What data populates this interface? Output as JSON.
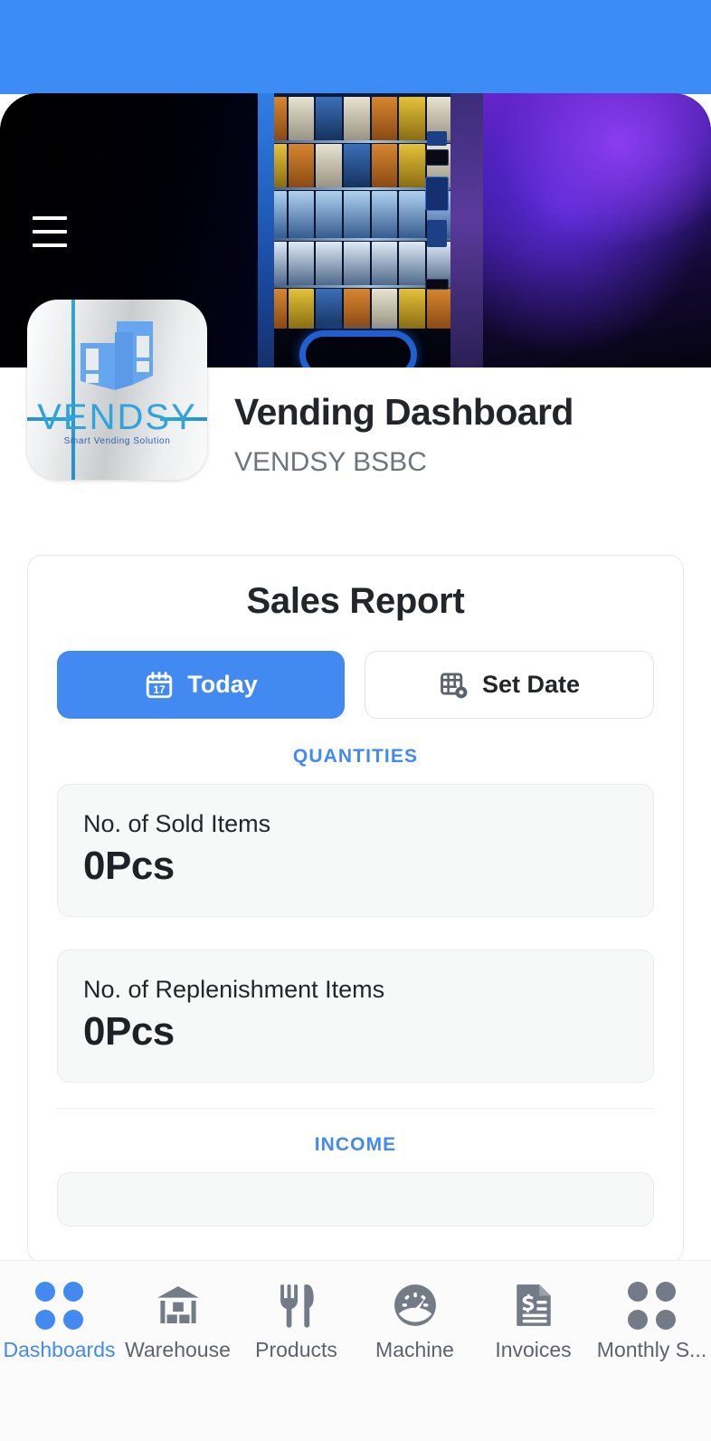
{
  "statusbar": {
    "color": "#3d8bf5"
  },
  "hero": {
    "menu_icon": "hamburger-menu-icon",
    "image_alt": "vending-machine-photo"
  },
  "app": {
    "logo": {
      "wordmark": "VENDSY",
      "tagline": "Smart Vending Solution",
      "icon_name": "vendsy-machine-logo"
    },
    "title": "Vending Dashboard",
    "subtitle": "VENDSY BSBC"
  },
  "report": {
    "title": "Sales Report",
    "today_button": {
      "label": "Today",
      "icon": "calendar-17-icon",
      "active": true
    },
    "set_date_button": {
      "label": "Set Date",
      "icon": "calendar-settings-icon",
      "active": false
    },
    "sections": [
      {
        "label": "QUANTITIES",
        "stats": [
          {
            "label": "No. of Sold Items",
            "value": "0Pcs"
          },
          {
            "label": "No. of Replenishment Items",
            "value": "0Pcs"
          }
        ]
      },
      {
        "label": "INCOME",
        "stats": []
      }
    ]
  },
  "bottom_nav": {
    "items": [
      {
        "label": "Dashboards",
        "icon": "dots-grid-icon",
        "active": true
      },
      {
        "label": "Warehouse",
        "icon": "warehouse-icon",
        "active": false
      },
      {
        "label": "Products",
        "icon": "fork-knife-icon",
        "active": false
      },
      {
        "label": "Machine",
        "icon": "gauge-icon",
        "active": false
      },
      {
        "label": "Invoices",
        "icon": "invoice-dollar-icon",
        "active": false
      },
      {
        "label": "Monthly S...",
        "icon": "dots-grid-icon",
        "active": false
      }
    ]
  },
  "colors": {
    "accent": "#4289f2",
    "status_bar": "#3d8bf5",
    "text_primary": "#22262b",
    "text_muted": "#6e757d",
    "nav_inactive": "#5c636d",
    "card_bg": "#f7f9f8"
  }
}
